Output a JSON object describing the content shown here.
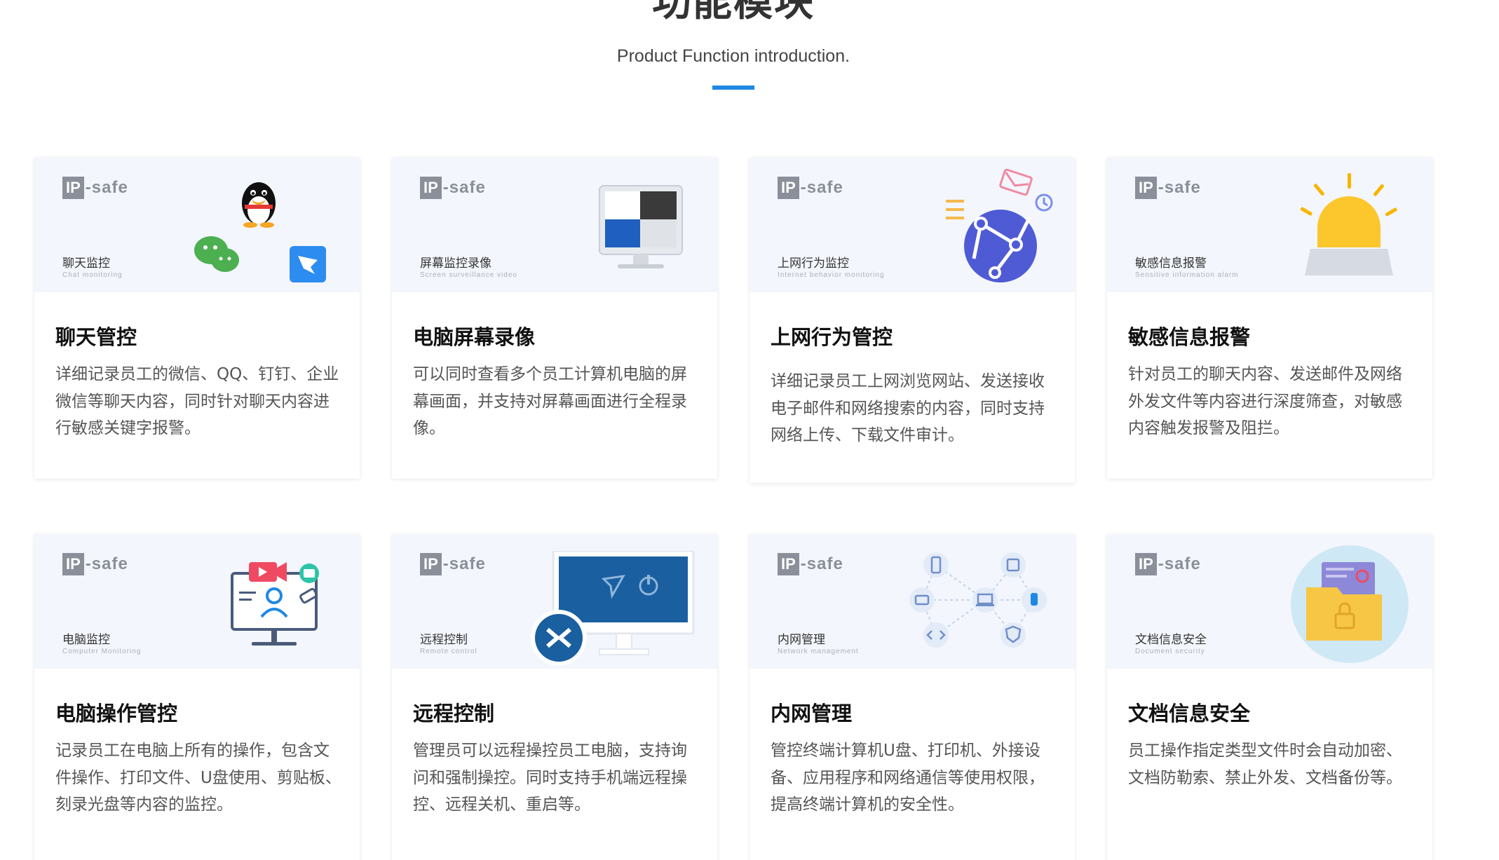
{
  "section": {
    "title": "功能模块",
    "subtitle": "Product Function introduction."
  },
  "brand": {
    "logo_ip": "IP",
    "logo_safe": "-safe"
  },
  "cards": [
    {
      "banner_label": "聊天监控",
      "banner_sub": "Chat monitoring",
      "title": "聊天管控",
      "desc": "详细记录员工的微信、QQ、钉钉、企业微信等聊天内容，同时针对聊天内容进行敏感关键字报警。"
    },
    {
      "banner_label": "屏幕监控录像",
      "banner_sub": "Screen surveillance video",
      "title": "电脑屏幕录像",
      "desc": "可以同时查看多个员工计算机电脑的屏幕画面，并支持对屏幕画面进行全程录像。"
    },
    {
      "banner_label": "上网行为监控",
      "banner_sub": "Internet behavior monitoring",
      "title": "上网行为管控",
      "desc": "详细记录员工上网浏览网站、发送接收电子邮件和网络搜索的内容，同时支持网络上传、下载文件审计。"
    },
    {
      "banner_label": "敏感信息报警",
      "banner_sub": "Sensitive information alarm",
      "title": "敏感信息报警",
      "desc": "针对员工的聊天内容、发送邮件及网络外发文件等内容进行深度筛查，对敏感内容触发报警及阻拦。"
    },
    {
      "banner_label": "电脑监控",
      "banner_sub": "Computer Monitoring",
      "title": "电脑操作管控",
      "desc": "记录员工在电脑上所有的操作，包含文件操作、打印文件、U盘使用、剪贴板、刻录光盘等内容的监控。"
    },
    {
      "banner_label": "远程控制",
      "banner_sub": "Remote control",
      "title": "远程控制",
      "desc": "管理员可以远程操控员工电脑，支持询问和强制操控。同时支持手机端远程操控、远程关机、重启等。"
    },
    {
      "banner_label": "内网管理",
      "banner_sub": "Network management",
      "title": "内网管理",
      "desc": "管控终端计算机U盘、打印机、外接设备、应用程序和网络通信等使用权限，提高终端计算机的安全性。"
    },
    {
      "banner_label": "文档信息安全",
      "banner_sub": "Document security",
      "title": "文档信息安全",
      "desc": "员工操作指定类型文件时会自动加密、文档防勒索、禁止外发、文档备份等。"
    }
  ]
}
